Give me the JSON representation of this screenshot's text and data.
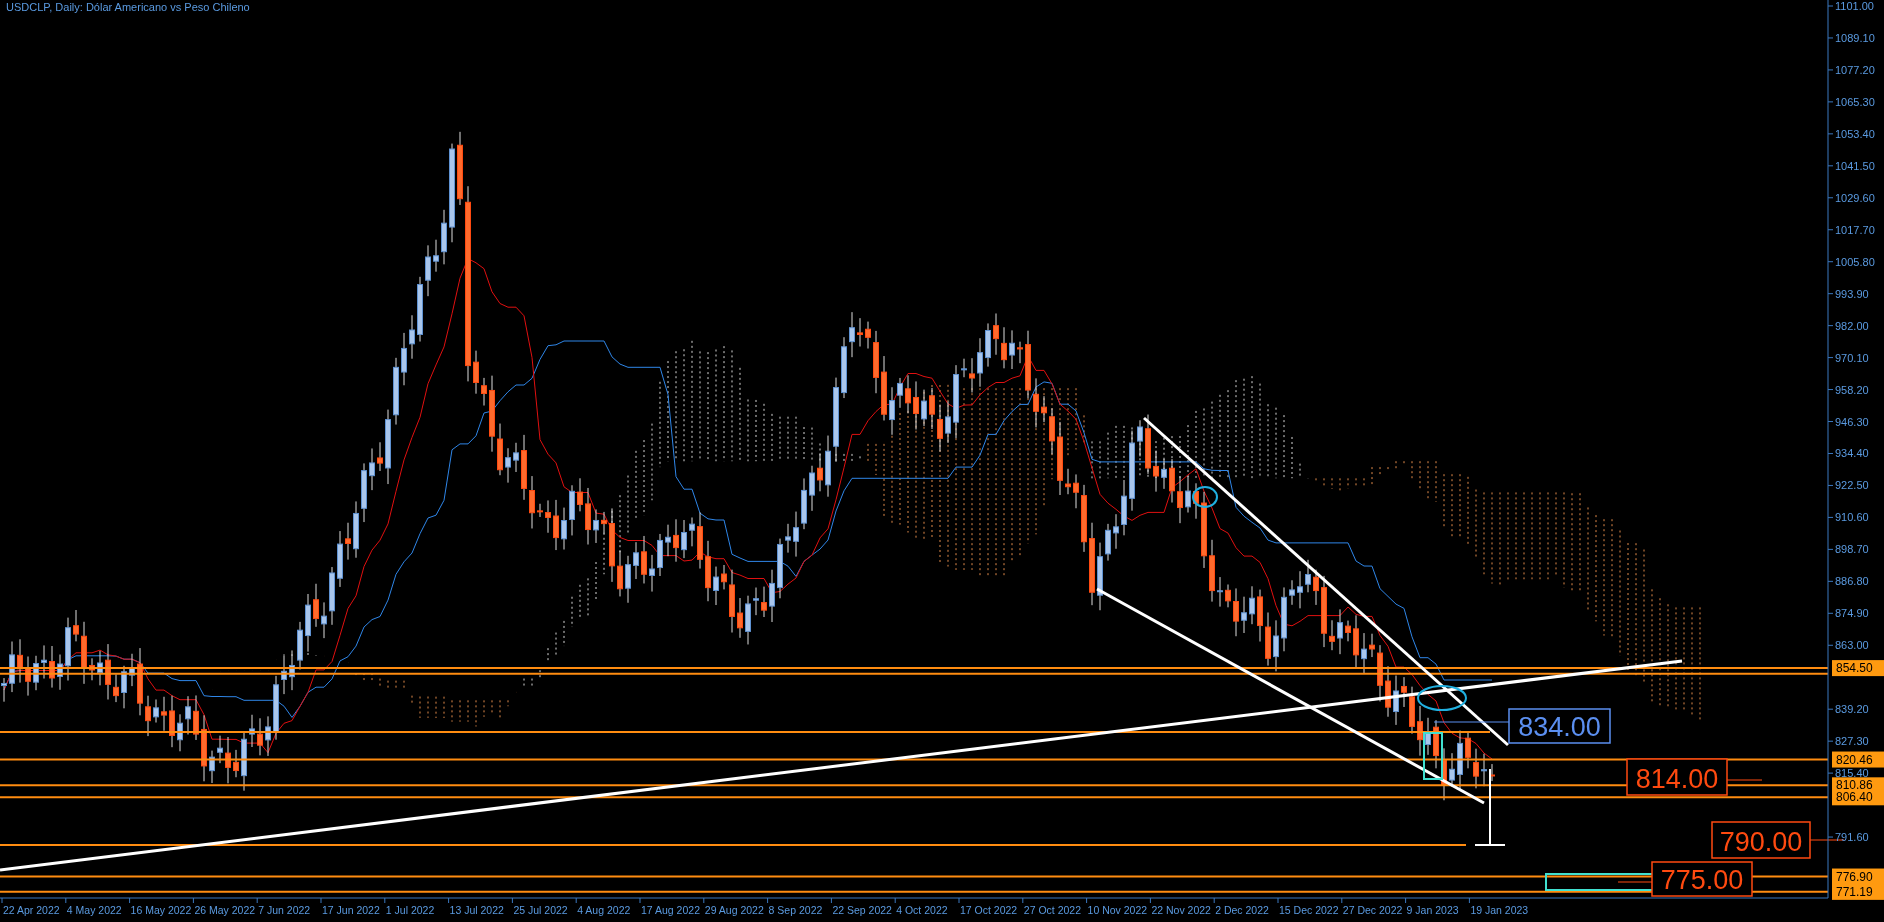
{
  "window": {
    "title": "USDCLP, Daily:  Dólar Americano vs Peso Chileno"
  },
  "price_axis": {
    "ticks": [
      "1101.00",
      "1089.10",
      "1077.20",
      "1065.30",
      "1053.40",
      "1041.50",
      "1029.60",
      "1017.70",
      "1005.80",
      "993.90",
      "982.00",
      "970.10",
      "958.20",
      "946.30",
      "934.40",
      "922.50",
      "910.60",
      "898.70",
      "886.80",
      "874.90",
      "863.00",
      "839.20",
      "827.30",
      "815.40",
      "791.60"
    ]
  },
  "time_axis": {
    "labels": [
      "22 Apr 2022",
      "4 May 2022",
      "16 May 2022",
      "26 May 2022",
      "7 Jun 2022",
      "17 Jun 2022",
      "1 Jul 2022",
      "13 Jul 2022",
      "25 Jul 2022",
      "4 Aug 2022",
      "17 Aug 2022",
      "29 Aug 2022",
      "8 Sep 2022",
      "22 Sep 2022",
      "4 Oct 2022",
      "17 Oct 2022",
      "27 Oct 2022",
      "10 Nov 2022",
      "22 Nov 2022",
      "2 Dec 2022",
      "15 Dec 2022",
      "27 Dec 2022",
      "9 Jan 2023",
      "19 Jan 2023"
    ]
  },
  "price_tags": [
    {
      "text": "854.50"
    },
    {
      "text": "820.46"
    },
    {
      "text": "810.86"
    },
    {
      "text": "806.40"
    },
    {
      "text": "776.90"
    },
    {
      "text": "771.19"
    }
  ],
  "annotations": [
    {
      "text": "834.00",
      "color": "#5b8ff0"
    },
    {
      "text": "814.00",
      "color": "#ff4a10"
    },
    {
      "text": "790.00",
      "color": "#ff4a10"
    },
    {
      "text": "775.00",
      "color": "#ff4a10"
    }
  ]
}
